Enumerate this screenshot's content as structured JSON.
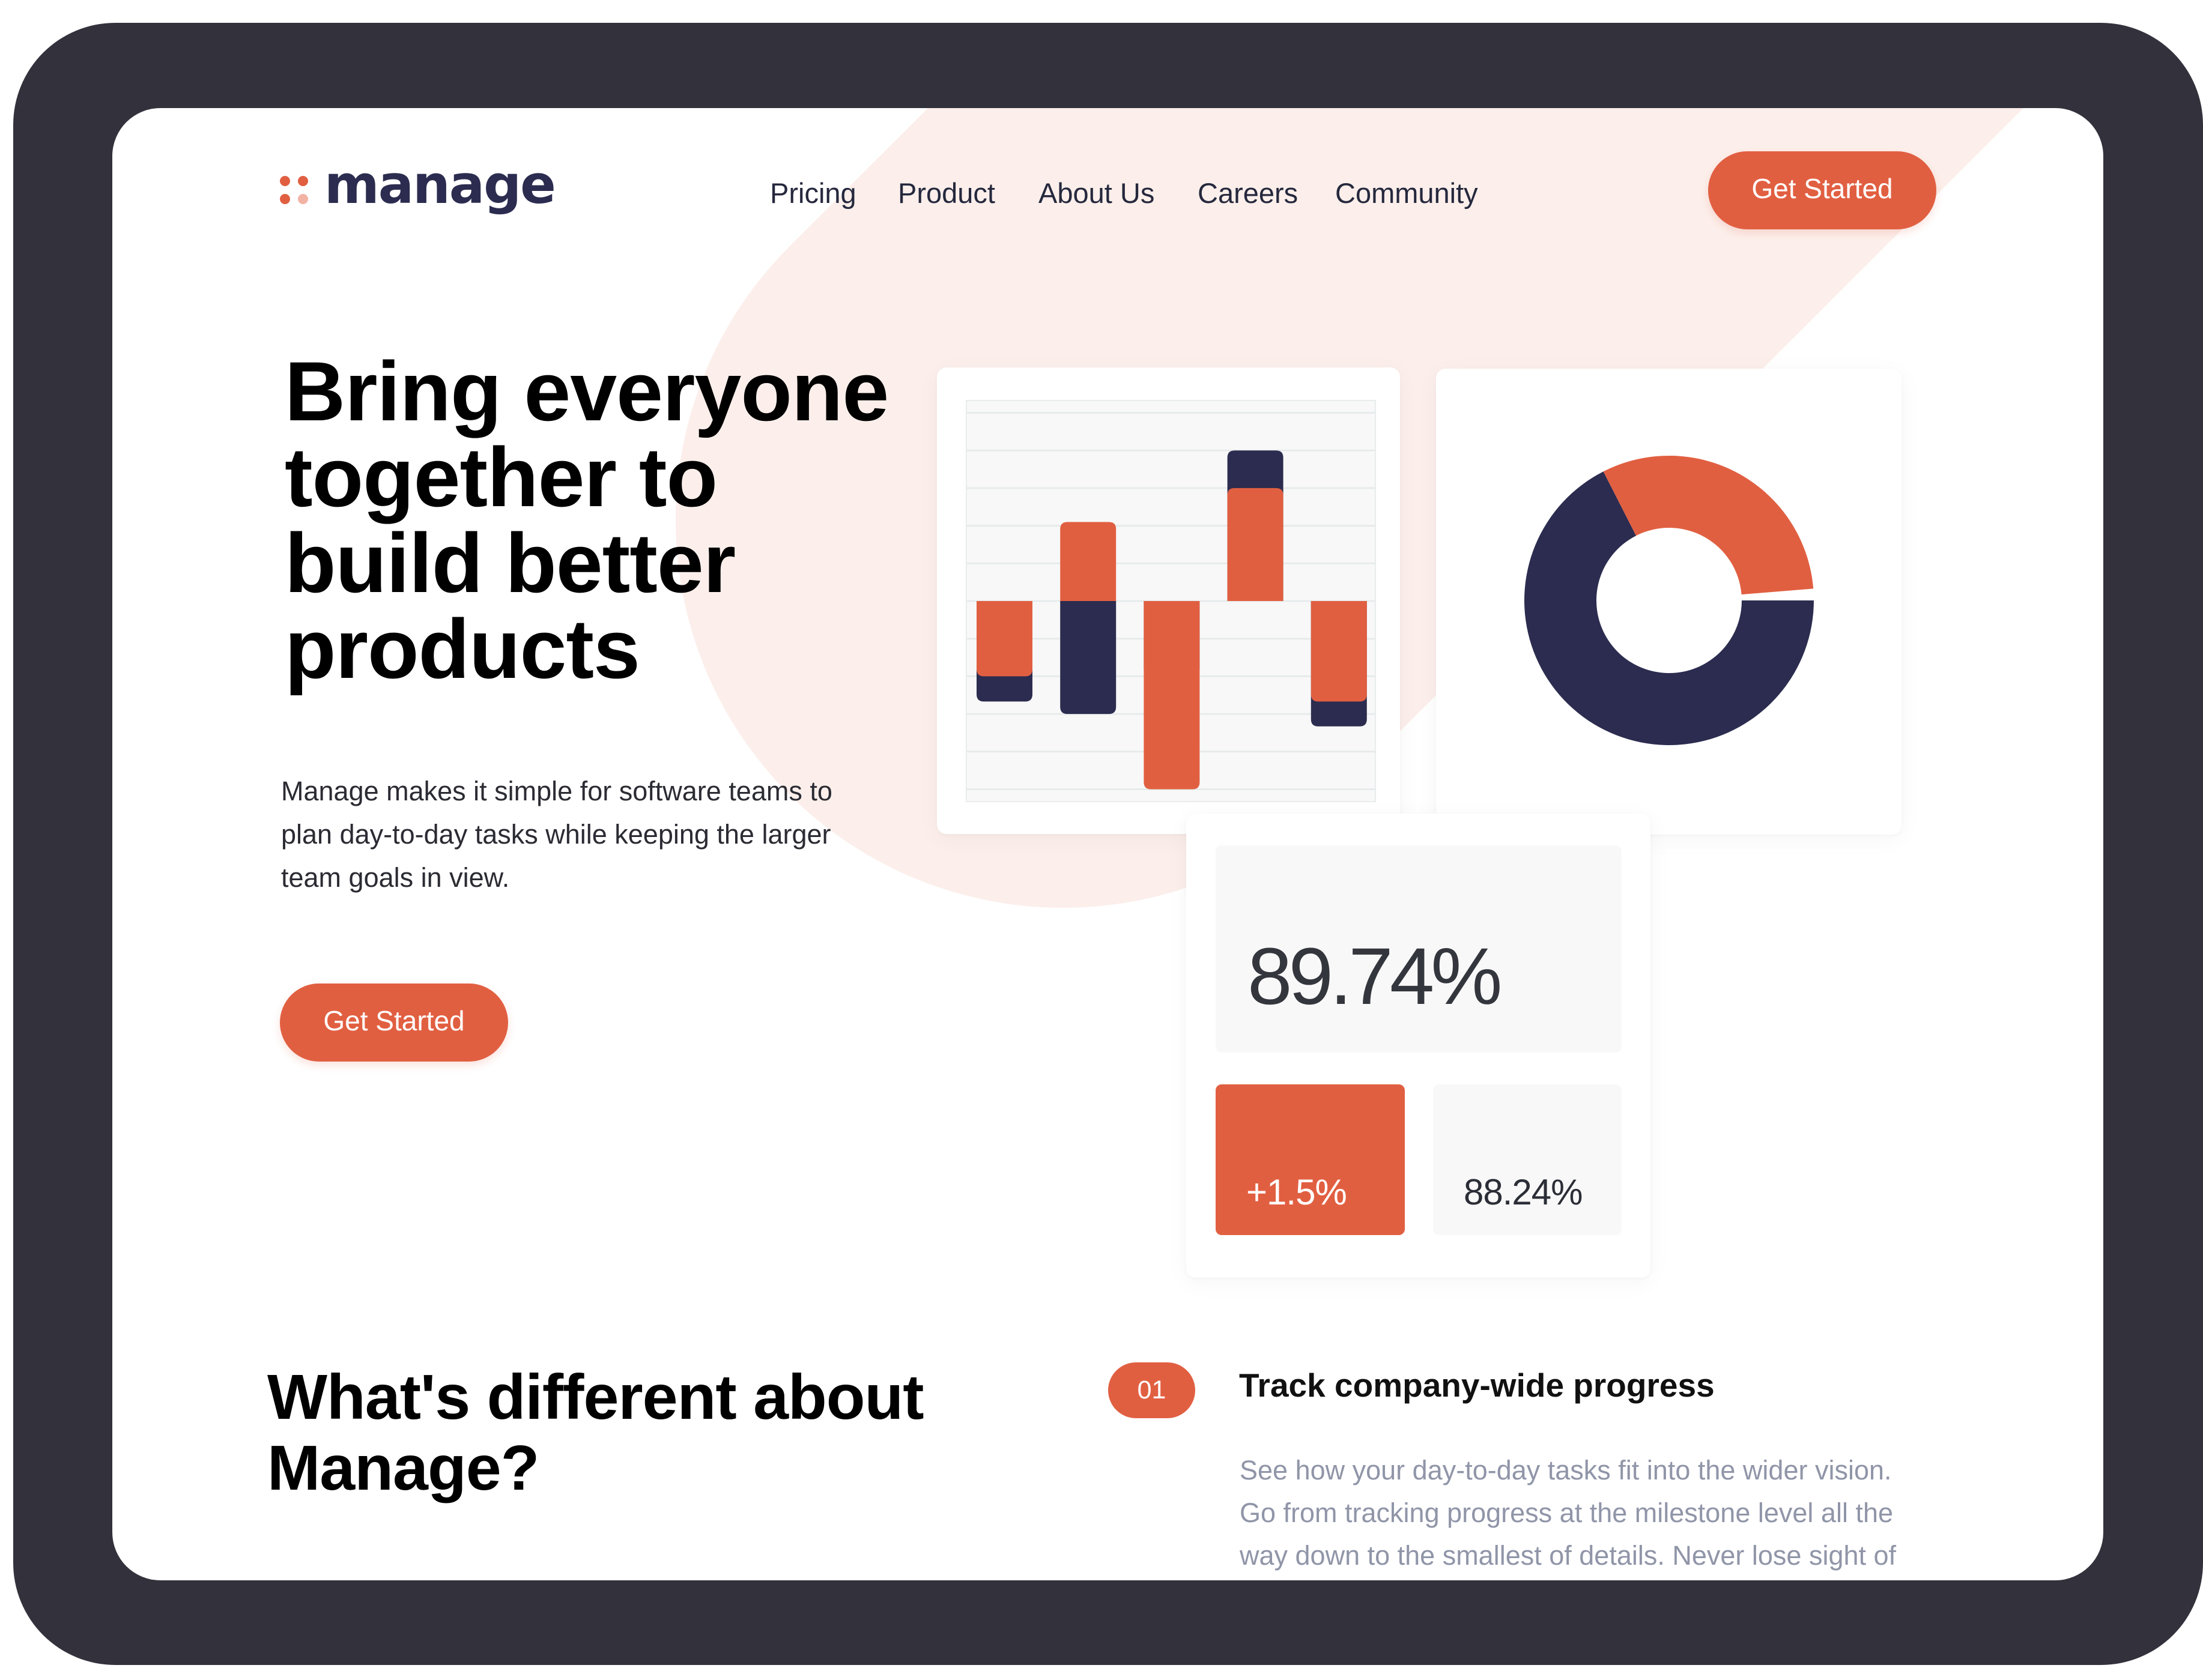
{
  "colors": {
    "accent": "#e15f41",
    "navy": "#2b2c4f",
    "band": "#fcefeb",
    "bezel": "#33313b"
  },
  "logo": {
    "text": "manage",
    "icon": "four-dots-icon"
  },
  "nav": {
    "items": [
      {
        "label": "Pricing"
      },
      {
        "label": "Product"
      },
      {
        "label": "About Us"
      },
      {
        "label": "Careers"
      },
      {
        "label": "Community"
      }
    ],
    "cta_label": "Get Started"
  },
  "hero": {
    "title_lines": [
      "Bring everyone",
      "together to",
      "build better",
      "products"
    ],
    "text_lines": [
      "Manage makes it simple for software teams to",
      "plan day-to-day tasks while keeping the larger",
      "team goals in view."
    ],
    "cta_label": "Get Started"
  },
  "stats": {
    "main_value": "89.74%",
    "change_value": "+1.5%",
    "secondary_value": "88.24%"
  },
  "features": {
    "title_lines": [
      "What's different about",
      "Manage?"
    ],
    "items": [
      {
        "number": "01",
        "title": "Track company-wide progress",
        "description_lines": [
          "See how your day-to-day tasks fit into the wider vision.",
          "Go from tracking progress at the milestone level all the",
          "way down to the smallest of details. Never lose sight of"
        ]
      }
    ]
  },
  "chart_data": [
    {
      "type": "bar",
      "title": "",
      "xlabel": "",
      "ylabel": "",
      "categories": [
        "1",
        "2",
        "3",
        "4",
        "5"
      ],
      "series": [
        {
          "name": "navy",
          "color": "#2b2c4f",
          "values": [
            -2.67,
            -3.0,
            -2.0,
            4.0,
            -3.33
          ]
        },
        {
          "name": "orange",
          "color": "#e15f41",
          "values": [
            -2.0,
            2.1,
            -5.0,
            3.0,
            -2.67
          ]
        }
      ],
      "ylim": [
        -5.5,
        5.5
      ],
      "gridlines": [
        5,
        4,
        3,
        2,
        1,
        0,
        -1,
        -2,
        -3,
        -4,
        -5
      ],
      "grid": true,
      "overlapping": true,
      "legend": "none",
      "tick_labels": "none"
    },
    {
      "type": "pie",
      "variant": "donut",
      "title": "",
      "slices": [
        {
          "name": "navy",
          "color": "#2b2c4f",
          "value": 67.5
        },
        {
          "name": "orange",
          "color": "#e15f41",
          "value": 31.2
        },
        {
          "name": "gap",
          "color": "#ffffff",
          "value": 1.3
        }
      ],
      "start": "3 o'clock, clockwise",
      "legend": "none"
    }
  ]
}
